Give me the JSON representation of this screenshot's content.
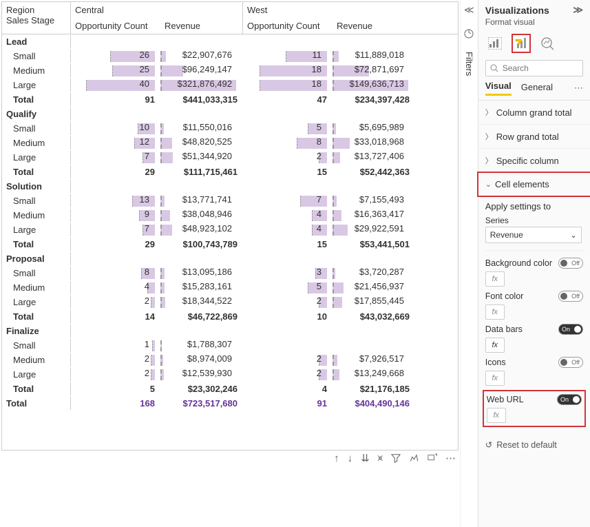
{
  "matrix": {
    "corner0": "Region",
    "corner1": "Sales Stage",
    "regions": [
      "Central",
      "West"
    ],
    "measures": [
      "Opportunity Count",
      "Revenue"
    ],
    "stages": [
      {
        "name": "Lead",
        "rows": [
          {
            "label": "Small",
            "oc1": "26",
            "rev1": "$22,907,676",
            "oc2": "11",
            "rev2": "$11,889,018",
            "oc1b": 65,
            "rev1b": 8,
            "oc2b": 60,
            "rev2b": 9
          },
          {
            "label": "Medium",
            "oc1": "25",
            "rev1": "$96,249,147",
            "oc2": "18",
            "rev2": "$72,871,697",
            "oc1b": 62,
            "rev1b": 33,
            "oc2b": 98,
            "rev2b": 53
          },
          {
            "label": "Large",
            "oc1": "40",
            "rev1": "$321,876,492",
            "oc2": "18",
            "rev2": "$149,636,713",
            "oc1b": 100,
            "rev1b": 110,
            "oc2b": 98,
            "rev2b": 110
          }
        ],
        "total": {
          "label": "Total",
          "oc1": "91",
          "rev1": "$441,033,315",
          "oc2": "47",
          "rev2": "$234,397,428"
        }
      },
      {
        "name": "Qualify",
        "rows": [
          {
            "label": "Small",
            "oc1": "10",
            "rev1": "$11,550,016",
            "oc2": "5",
            "rev2": "$5,695,989",
            "oc1b": 25,
            "rev1b": 5,
            "oc2b": 28,
            "rev2b": 5
          },
          {
            "label": "Medium",
            "oc1": "12",
            "rev1": "$48,820,525",
            "oc2": "8",
            "rev2": "$33,018,968",
            "oc1b": 30,
            "rev1b": 17,
            "oc2b": 44,
            "rev2b": 25
          },
          {
            "label": "Large",
            "oc1": "7",
            "rev1": "$51,344,920",
            "oc2": "2",
            "rev2": "$13,727,406",
            "oc1b": 18,
            "rev1b": 18,
            "oc2b": 12,
            "rev2b": 11
          }
        ],
        "total": {
          "label": "Total",
          "oc1": "29",
          "rev1": "$111,715,461",
          "oc2": "15",
          "rev2": "$52,442,363"
        }
      },
      {
        "name": "Solution",
        "rows": [
          {
            "label": "Small",
            "oc1": "13",
            "rev1": "$13,771,741",
            "oc2": "7",
            "rev2": "$7,155,493",
            "oc1b": 33,
            "rev1b": 6,
            "oc2b": 39,
            "rev2b": 6
          },
          {
            "label": "Medium",
            "oc1": "9",
            "rev1": "$38,048,946",
            "oc2": "4",
            "rev2": "$16,363,417",
            "oc1b": 23,
            "rev1b": 14,
            "oc2b": 22,
            "rev2b": 13
          },
          {
            "label": "Large",
            "oc1": "7",
            "rev1": "$48,923,102",
            "oc2": "4",
            "rev2": "$29,922,591",
            "oc1b": 18,
            "rev1b": 17,
            "oc2b": 22,
            "rev2b": 22
          }
        ],
        "total": {
          "label": "Total",
          "oc1": "29",
          "rev1": "$100,743,789",
          "oc2": "15",
          "rev2": "$53,441,501"
        }
      },
      {
        "name": "Proposal",
        "rows": [
          {
            "label": "Small",
            "oc1": "8",
            "rev1": "$13,095,186",
            "oc2": "3",
            "rev2": "$3,720,287",
            "oc1b": 20,
            "rev1b": 6,
            "oc2b": 17,
            "rev2b": 4
          },
          {
            "label": "Medium",
            "oc1": "4",
            "rev1": "$15,283,161",
            "oc2": "5",
            "rev2": "$21,456,937",
            "oc1b": 11,
            "rev1b": 6,
            "oc2b": 28,
            "rev2b": 16
          },
          {
            "label": "Large",
            "oc1": "2",
            "rev1": "$18,344,522",
            "oc2": "2",
            "rev2": "$17,855,445",
            "oc1b": 6,
            "rev1b": 7,
            "oc2b": 12,
            "rev2b": 14
          }
        ],
        "total": {
          "label": "Total",
          "oc1": "14",
          "rev1": "$46,722,869",
          "oc2": "10",
          "rev2": "$43,032,669"
        }
      },
      {
        "name": "Finalize",
        "rows": [
          {
            "label": "Small",
            "oc1": "1",
            "rev1": "$1,788,307",
            "oc2": "",
            "rev2": "",
            "oc1b": 4,
            "rev1b": 2,
            "oc2b": 0,
            "rev2b": 0
          },
          {
            "label": "Medium",
            "oc1": "2",
            "rev1": "$8,974,009",
            "oc2": "2",
            "rev2": "$7,926,517",
            "oc1b": 6,
            "rev1b": 4,
            "oc2b": 12,
            "rev2b": 7
          },
          {
            "label": "Large",
            "oc1": "2",
            "rev1": "$12,539,930",
            "oc2": "2",
            "rev2": "$13,249,668",
            "oc1b": 6,
            "rev1b": 5,
            "oc2b": 12,
            "rev2b": 10
          }
        ],
        "total": {
          "label": "Total",
          "oc1": "5",
          "rev1": "$23,302,246",
          "oc2": "4",
          "rev2": "$21,176,185"
        }
      }
    ],
    "grand_total": {
      "label": "Total",
      "oc1": "168",
      "rev1": "$723,517,680",
      "oc2": "91",
      "rev2": "$404,490,146"
    }
  },
  "filters_label": "Filters",
  "panel": {
    "title": "Visualizations",
    "subtitle": "Format visual",
    "search_ph": "Search",
    "tab_visual": "Visual",
    "tab_general": "General",
    "sections": {
      "col_grand": "Column grand total",
      "row_grand": "Row grand total",
      "specific": "Specific column",
      "cell": "Cell elements"
    },
    "apply_to": "Apply settings to",
    "series_label": "Series",
    "series_value": "Revenue",
    "toggles": {
      "bg": "Background color",
      "font": "Font color",
      "bars": "Data bars",
      "icons": "Icons",
      "weburl": "Web URL"
    },
    "on": "On",
    "off": "Off",
    "fx": "fx",
    "reset": "Reset to default"
  }
}
